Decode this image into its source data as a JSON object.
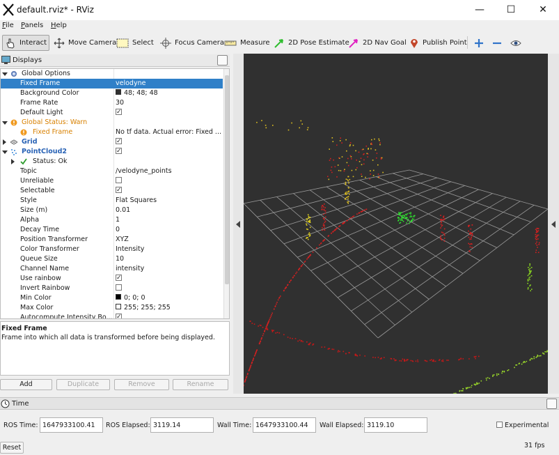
{
  "window": {
    "title": "default.rviz* - RViz"
  },
  "menu": [
    {
      "label": "File",
      "mnemonic": "F",
      "rest": "ile"
    },
    {
      "label": "Panels",
      "mnemonic": "P",
      "rest": "anels"
    },
    {
      "label": "Help",
      "mnemonic": "H",
      "rest": "elp"
    }
  ],
  "toolbar": {
    "interact": "Interact",
    "move_camera": "Move Camera",
    "select": "Select",
    "focus_camera": "Focus Camera",
    "measure": "Measure",
    "pose_estimate": "2D Pose Estimate",
    "nav_goal": "2D Nav Goal",
    "publish_point": "Publish Point"
  },
  "displays": {
    "title": "Displays",
    "rows": [
      {
        "key": "Global Options",
        "value": ""
      },
      {
        "key": "Fixed Frame",
        "value": "velodyne"
      },
      {
        "key": "Background Color",
        "value": "48; 48; 48"
      },
      {
        "key": "Frame Rate",
        "value": "30"
      },
      {
        "key": "Default Light",
        "value": ""
      },
      {
        "key": "Global Status: Warn",
        "value": ""
      },
      {
        "key": "Fixed Frame",
        "value": "No tf data.  Actual error: Fixed ..."
      },
      {
        "key": "Grid",
        "value": ""
      },
      {
        "key": "PointCloud2",
        "value": ""
      },
      {
        "key": "Status: Ok",
        "value": ""
      },
      {
        "key": "Topic",
        "value": "/velodyne_points"
      },
      {
        "key": "Unreliable",
        "value": ""
      },
      {
        "key": "Selectable",
        "value": ""
      },
      {
        "key": "Style",
        "value": "Flat Squares"
      },
      {
        "key": "Size (m)",
        "value": "0.01"
      },
      {
        "key": "Alpha",
        "value": "1"
      },
      {
        "key": "Decay Time",
        "value": "0"
      },
      {
        "key": "Position Transformer",
        "value": "XYZ"
      },
      {
        "key": "Color Transformer",
        "value": "Intensity"
      },
      {
        "key": "Queue Size",
        "value": "10"
      },
      {
        "key": "Channel Name",
        "value": "intensity"
      },
      {
        "key": "Use rainbow",
        "value": ""
      },
      {
        "key": "Invert Rainbow",
        "value": ""
      },
      {
        "key": "Min Color",
        "value": "0; 0; 0"
      },
      {
        "key": "Max Color",
        "value": "255; 255; 255"
      },
      {
        "key": "Autocompute Intensity Bo...",
        "value": ""
      }
    ],
    "description_title": "Fixed Frame",
    "description_text": "Frame into which all data is transformed before being displayed.",
    "buttons": {
      "add": "Add",
      "duplicate": "Duplicate",
      "remove": "Remove",
      "rename": "Rename"
    }
  },
  "colors": {
    "background": "#303030",
    "selected": "#3080c8",
    "warn": "#d88000",
    "display_name": "#2862b5",
    "max_color": "#ffffff",
    "min_color": "#000000"
  },
  "time": {
    "title": "Time",
    "ros_time_label": "ROS Time:",
    "ros_time": "1647933100.41",
    "ros_elapsed_label": "ROS Elapsed:",
    "ros_elapsed": "3119.14",
    "wall_time_label": "Wall Time:",
    "wall_time": "1647933100.44",
    "wall_elapsed_label": "Wall Elapsed:",
    "wall_elapsed": "3119.10",
    "experimental_label": "Experimental",
    "reset": "Reset",
    "fps": "31 fps"
  }
}
